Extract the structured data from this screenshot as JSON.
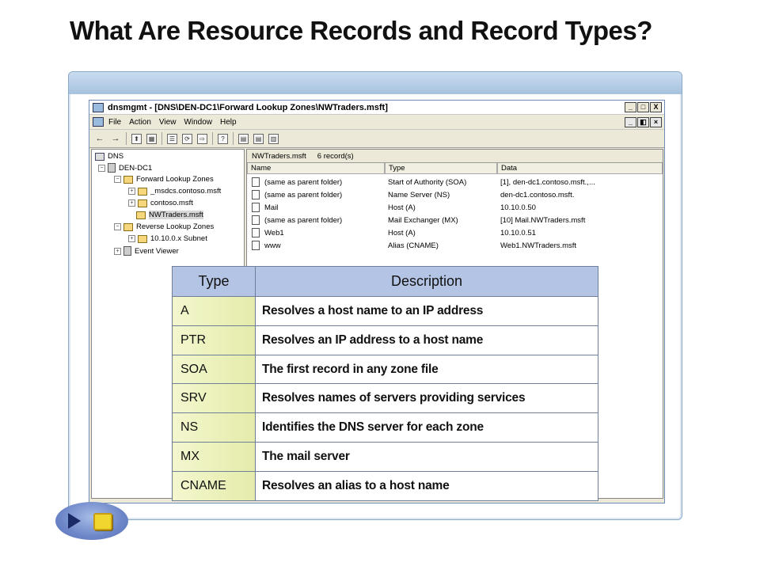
{
  "slide": {
    "title": "What Are Resource Records and Record Types?"
  },
  "window": {
    "title": "dnsmgmt - [DNS\\DEN-DC1\\Forward Lookup Zones\\NWTraders.msft]",
    "buttons": {
      "minimize": "_",
      "restore": "□",
      "close": "X"
    },
    "mdi_buttons": {
      "minimize": "_",
      "restore": "◧",
      "close": "×"
    },
    "menu": [
      "File",
      "Action",
      "View",
      "Window",
      "Help"
    ],
    "toolbar": [
      "←",
      "→",
      "⬆",
      "▦",
      "☰",
      "⟳",
      "⇨",
      "?",
      "▤",
      "▤",
      "▥"
    ]
  },
  "tree": {
    "root": "DNS",
    "server": "DEN-DC1",
    "forward_zones": "Forward Lookup Zones",
    "zone_msdcs": "_msdcs.contoso.msft",
    "zone_contoso": "contoso.msft",
    "zone_nwtraders": "NWTraders.msft",
    "reverse_zones": "Reverse Lookup Zones",
    "reverse_subnet": "10.10.0.x Subnet",
    "event_viewer": "Event Viewer"
  },
  "records_pane": {
    "zone_name": "NWTraders.msft",
    "count": "6 record(s)",
    "columns": [
      "Name",
      "Type",
      "Data"
    ],
    "rows": [
      {
        "name": "(same as parent folder)",
        "type": "Start of Authority (SOA)",
        "data": "[1], den-dc1.contoso.msft.,..."
      },
      {
        "name": "(same as parent folder)",
        "type": "Name Server (NS)",
        "data": "den-dc1.contoso.msft."
      },
      {
        "name": "Mail",
        "type": "Host (A)",
        "data": "10.10.0.50"
      },
      {
        "name": "(same as parent folder)",
        "type": "Mail Exchanger (MX)",
        "data": "[10] Mail.NWTraders.msft"
      },
      {
        "name": "Web1",
        "type": "Host (A)",
        "data": "10.10.0.51"
      },
      {
        "name": "www",
        "type": "Alias (CNAME)",
        "data": "Web1.NWTraders.msft"
      }
    ]
  },
  "record_types_table": {
    "headers": [
      "Type",
      "Description"
    ],
    "rows": [
      {
        "type": "A",
        "description": "Resolves a host name to an IP address"
      },
      {
        "type": "PTR",
        "description": "Resolves an IP address to a host name"
      },
      {
        "type": "SOA",
        "description": "The first record in any zone file"
      },
      {
        "type": "SRV",
        "description": "Resolves names of servers providing services"
      },
      {
        "type": "NS",
        "description": "Identifies the DNS server for each zone"
      },
      {
        "type": "MX",
        "description": "The mail server"
      },
      {
        "type": "CNAME",
        "description": "Resolves an alias to a host name"
      }
    ]
  },
  "icons": {
    "app": "dns-console-icon",
    "nav_play": "play-icon",
    "nav_stop": "stop-icon",
    "record": "document-icon"
  },
  "colors": {
    "header_fill": "#b4c4e4",
    "type_cell_fill": "#e4ebaa",
    "frame_band": "#a7c2df",
    "nav_stop": "#f2d630"
  }
}
